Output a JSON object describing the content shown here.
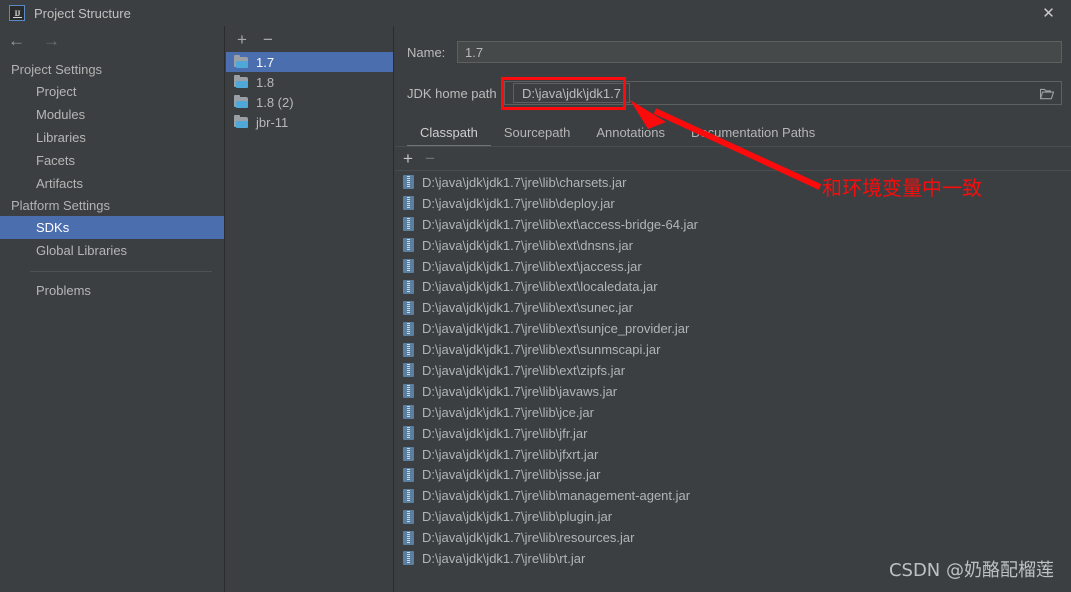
{
  "window": {
    "title": "Project Structure",
    "logo_icon": "intellij-idea-icon",
    "close_icon": "✕"
  },
  "left_nav": {
    "back_icon": "←",
    "forward_icon": "→",
    "groups": [
      {
        "label": "Project Settings",
        "items": [
          {
            "label": "Project",
            "selected": false
          },
          {
            "label": "Modules",
            "selected": false
          },
          {
            "label": "Libraries",
            "selected": false
          },
          {
            "label": "Facets",
            "selected": false
          },
          {
            "label": "Artifacts",
            "selected": false
          }
        ]
      },
      {
        "label": "Platform Settings",
        "items": [
          {
            "label": "SDKs",
            "selected": true
          },
          {
            "label": "Global Libraries",
            "selected": false
          }
        ]
      }
    ],
    "extra": [
      {
        "label": "Problems",
        "selected": false
      }
    ]
  },
  "sdk_list": {
    "toolbar": {
      "add_label": "+",
      "remove_label": "−"
    },
    "items": [
      {
        "label": "1.7",
        "selected": true
      },
      {
        "label": "1.8",
        "selected": false
      },
      {
        "label": "1.8 (2)",
        "selected": false
      },
      {
        "label": "jbr-11",
        "selected": false
      }
    ]
  },
  "detail": {
    "name_label": "Name:",
    "name_value": "1.7",
    "jdk_label": "JDK home path",
    "jdk_value": "D:\\java\\jdk\\jdk1.7",
    "browse_icon": "folder-open-icon",
    "tabs": [
      {
        "label": "Classpath",
        "active": true
      },
      {
        "label": "Sourcepath",
        "active": false
      },
      {
        "label": "Annotations",
        "active": false
      },
      {
        "label": "Documentation Paths",
        "active": false
      }
    ],
    "list_toolbar": {
      "add_label": "+",
      "remove_label": "−"
    },
    "classpath_entries": [
      "D:\\java\\jdk\\jdk1.7\\jre\\lib\\charsets.jar",
      "D:\\java\\jdk\\jdk1.7\\jre\\lib\\deploy.jar",
      "D:\\java\\jdk\\jdk1.7\\jre\\lib\\ext\\access-bridge-64.jar",
      "D:\\java\\jdk\\jdk1.7\\jre\\lib\\ext\\dnsns.jar",
      "D:\\java\\jdk\\jdk1.7\\jre\\lib\\ext\\jaccess.jar",
      "D:\\java\\jdk\\jdk1.7\\jre\\lib\\ext\\localedata.jar",
      "D:\\java\\jdk\\jdk1.7\\jre\\lib\\ext\\sunec.jar",
      "D:\\java\\jdk\\jdk1.7\\jre\\lib\\ext\\sunjce_provider.jar",
      "D:\\java\\jdk\\jdk1.7\\jre\\lib\\ext\\sunmscapi.jar",
      "D:\\java\\jdk\\jdk1.7\\jre\\lib\\ext\\zipfs.jar",
      "D:\\java\\jdk\\jdk1.7\\jre\\lib\\javaws.jar",
      "D:\\java\\jdk\\jdk1.7\\jre\\lib\\jce.jar",
      "D:\\java\\jdk\\jdk1.7\\jre\\lib\\jfr.jar",
      "D:\\java\\jdk\\jdk1.7\\jre\\lib\\jfxrt.jar",
      "D:\\java\\jdk\\jdk1.7\\jre\\lib\\jsse.jar",
      "D:\\java\\jdk\\jdk1.7\\jre\\lib\\management-agent.jar",
      "D:\\java\\jdk\\jdk1.7\\jre\\lib\\plugin.jar",
      "D:\\java\\jdk\\jdk1.7\\jre\\lib\\resources.jar",
      "D:\\java\\jdk\\jdk1.7\\jre\\lib\\rt.jar"
    ]
  },
  "annotation": {
    "text": "和环境变量中一致",
    "color": "#fb0b0b"
  },
  "watermark": {
    "text": "CSDN @奶酪配榴莲"
  },
  "colors": {
    "background": "#3c3f41",
    "selection": "#4b6eaf",
    "field_background": "#45494a",
    "border": "#5e6060",
    "annotation_red": "#fb0b0b",
    "jar_icon": "#5a7fa0",
    "folder_icon": "#4fa8d8"
  }
}
